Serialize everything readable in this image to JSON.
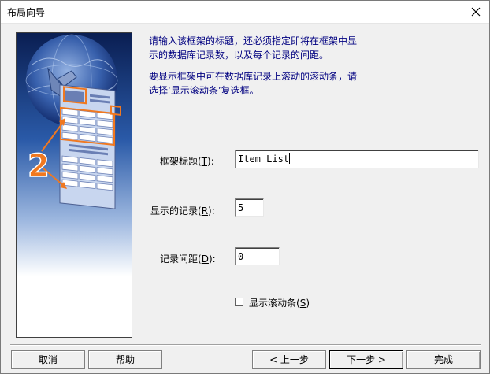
{
  "window": {
    "title": "布局向导"
  },
  "description": {
    "line1": "请输入该框架的标题，还必须指定即将在框架中显",
    "line2": "示的数据库记录数，以及每个记录的间距。",
    "line3": "要显示框架中可在数据库记录上滚动的滚动条，请",
    "line4": "选择‘显示滚动条’复选框。"
  },
  "form": {
    "frame_title": {
      "label": "框架标题(",
      "hotkey": "T",
      "label_end": "):",
      "value": "Item List"
    },
    "records_shown": {
      "label": "显示的记录(",
      "hotkey": "R",
      "label_end": "):",
      "value": "5"
    },
    "record_spacing": {
      "label": "记录间距(",
      "hotkey": "D",
      "label_end": "):",
      "value": "0"
    },
    "scrollbar": {
      "label": "显示滚动条(",
      "hotkey": "S",
      "label_end": ")",
      "checked": false
    }
  },
  "buttons": {
    "cancel": "取消",
    "help": "帮助",
    "back": "< 上一步",
    "next": "下一步 >",
    "finish": "完成"
  },
  "illustration": {
    "step_number": "2"
  },
  "colors": {
    "description_text": "#000080",
    "accent_orange": "#f07820",
    "panel_blue": "#1a3f8a"
  }
}
